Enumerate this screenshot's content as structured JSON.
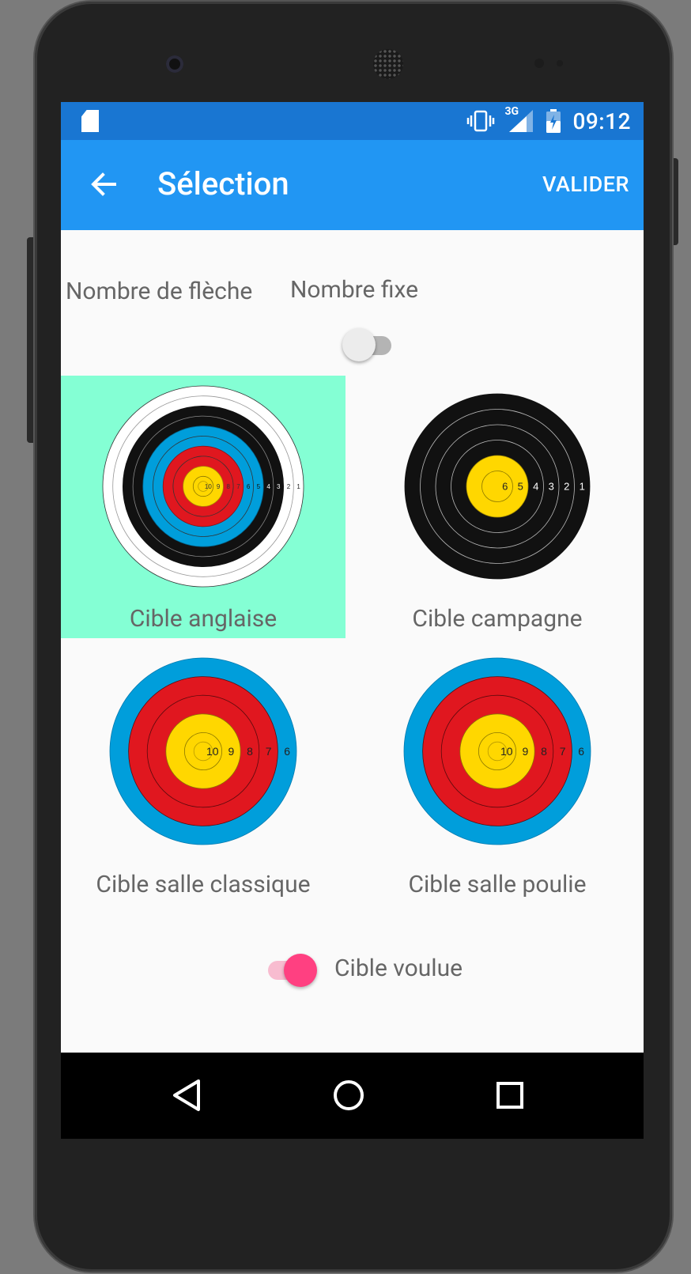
{
  "statusbar": {
    "network": "3G",
    "time": "09:12"
  },
  "appbar": {
    "title": "Sélection",
    "action": "VALIDER"
  },
  "options": {
    "arrow_count_label": "Nombre de flèche",
    "fixed_number_label": "Nombre fixe",
    "fixed_number_enabled": false
  },
  "targets": [
    {
      "name": "Cible anglaise",
      "selected": true
    },
    {
      "name": "Cible campagne",
      "selected": false
    },
    {
      "name": "Cible salle classique",
      "selected": false
    },
    {
      "name": "Cible salle poulie",
      "selected": false
    }
  ],
  "target_ring_labels": {
    "anglaise": [
      "10",
      "9",
      "8",
      "7",
      "6",
      "5",
      "4",
      "3",
      "2",
      "1"
    ],
    "campagne": [
      "6",
      "5",
      "4",
      "3",
      "2",
      "1"
    ],
    "salle": [
      "10",
      "9",
      "8",
      "7",
      "6"
    ]
  },
  "wanted_target": {
    "label": "Cible voulue",
    "enabled": true
  },
  "colors": {
    "statusbar": "#1976d2",
    "appbar": "#2196f3",
    "selected_bg": "#84ffd4",
    "accent": "#ff4081",
    "gold": "#ffd700",
    "red": "#e0171f",
    "blue": "#009edb",
    "black": "#111111"
  },
  "icons": [
    "sd-card-icon",
    "vibrate-icon",
    "signal-icon",
    "battery-icon",
    "back-arrow-icon",
    "nav-back-icon",
    "nav-home-icon",
    "nav-recents-icon"
  ]
}
